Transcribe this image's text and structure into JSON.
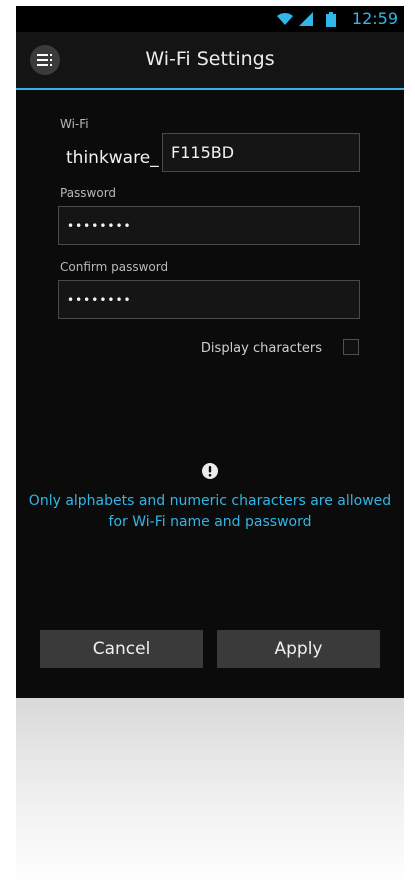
{
  "status_bar": {
    "time": "12:59",
    "icons": [
      "wifi-icon",
      "signal-icon",
      "battery-icon"
    ],
    "accent_color": "#31b6e7"
  },
  "app_bar": {
    "title": "Wi-Fi Settings",
    "menu_icon": "menu-icon"
  },
  "form": {
    "wifi_label": "Wi-Fi",
    "wifi_prefix": "thinkware_",
    "wifi_value": "F115BD",
    "password_label": "Password",
    "password_value": "••••••••",
    "confirm_label": "Confirm password",
    "confirm_value": "••••••••",
    "display_characters_label": "Display characters",
    "display_characters_checked": false
  },
  "notice": {
    "icon": "info-icon",
    "line1": "Only alphabets and numeric characters are allowed",
    "line2": "for Wi-Fi name and password"
  },
  "buttons": {
    "cancel": "Cancel",
    "apply": "Apply"
  }
}
